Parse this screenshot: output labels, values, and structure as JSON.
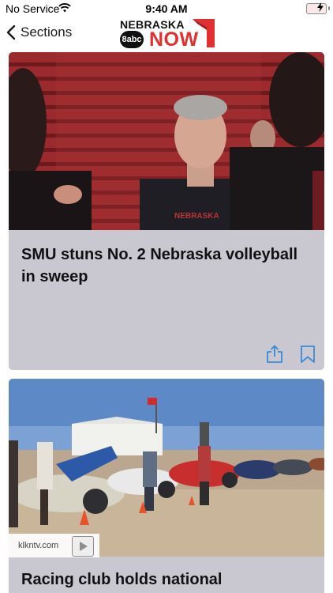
{
  "status_bar": {
    "carrier": "No Service",
    "time": "9:40 AM",
    "battery_icon": "battery-charging-icon"
  },
  "nav": {
    "back_label": "Sections",
    "logo": {
      "top_word": "NEBRASKA",
      "badge": "8abc",
      "bottom_word": "NOW"
    }
  },
  "accent_color": "#e1302f",
  "articles": [
    {
      "headline": "SMU stuns No. 2 Nebraska volleyball in sweep"
    },
    {
      "headline": "Racing club holds national",
      "source": "klkntv.com"
    }
  ]
}
